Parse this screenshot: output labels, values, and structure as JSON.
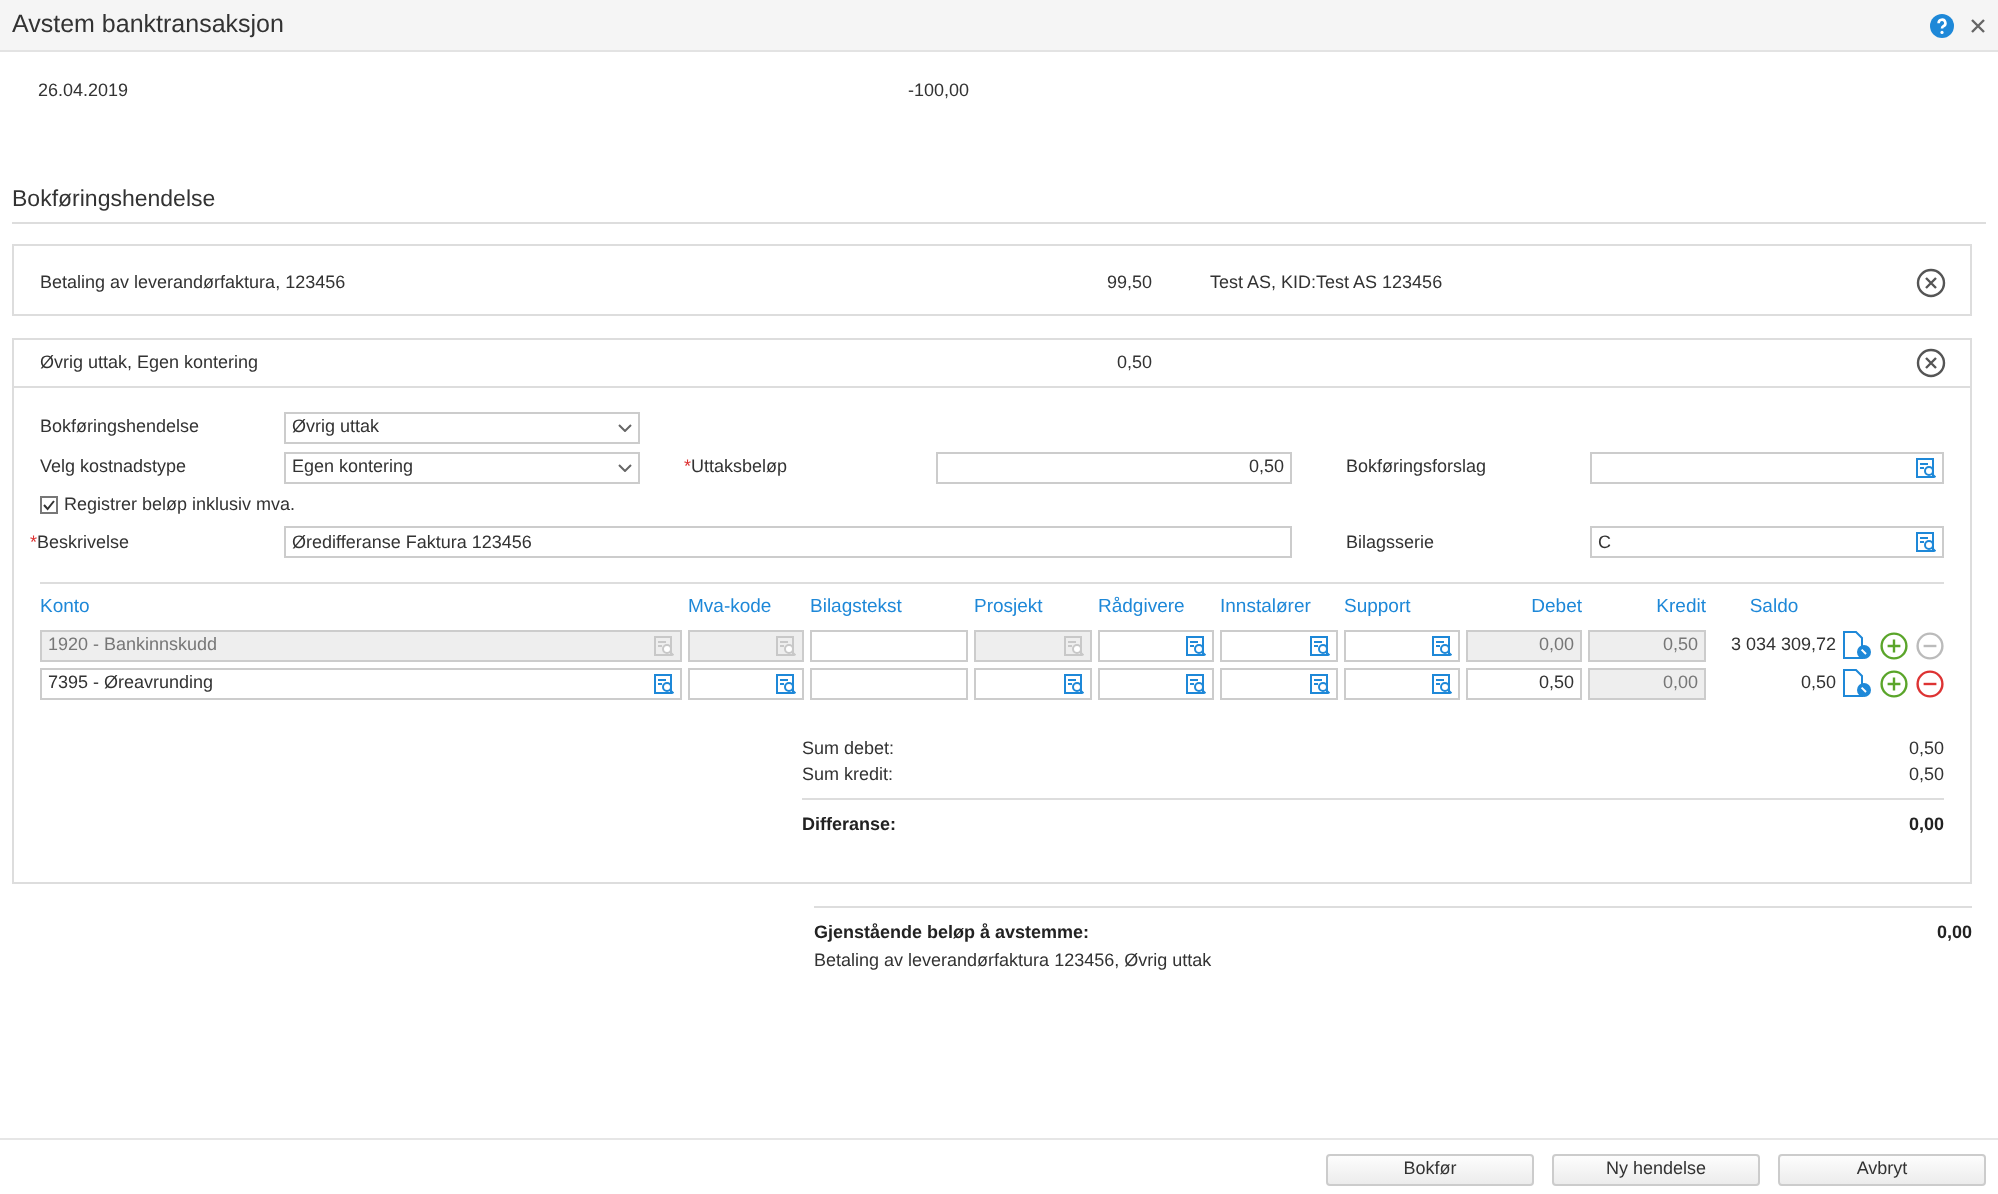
{
  "window": {
    "title": "Avstem banktransaksjon"
  },
  "transaction": {
    "date": "26.04.2019",
    "amount": "-100,00"
  },
  "section_title": "Bokføringshendelse",
  "events": [
    {
      "description": "Betaling av leverandørfaktura, 123456",
      "amount": "99,50",
      "reference": "Test AS, KID:Test AS 123456",
      "expanded": false
    },
    {
      "description": "Øvrig uttak, Egen kontering",
      "amount": "0,50",
      "expanded": true
    }
  ],
  "form": {
    "rows": [
      [
        {
          "kind": "select",
          "label": "Bokføringshendelse",
          "value": "Øvrig uttak"
        }
      ],
      [
        {
          "kind": "select",
          "label": "Velg kostnadstype",
          "value": "Egen kontering"
        },
        {
          "kind": "number",
          "label": "Uttaksbeløp",
          "required_mark": "*",
          "value": "0,50"
        },
        {
          "kind": "lookup",
          "label": "Bokføringsforslag"
        }
      ],
      [
        {
          "kind": "checkbox",
          "label": "Registrer beløp inklusiv mva.",
          "checked": true
        }
      ],
      [
        {
          "kind": "wide",
          "label": "Beskrivelse",
          "required_mark": "*",
          "value": "Øredifferanse Faktura 123456"
        },
        "",
        {
          "kind": "lookup",
          "label": "Bilagsserie",
          "value": "C"
        }
      ]
    ]
  },
  "table": {
    "columns": [
      "Konto",
      "Mva-kode",
      "Bilagstekst",
      "Prosjekt",
      "Rådgivere",
      "Innstalører",
      "Support",
      "Debet",
      "Kredit",
      "Saldo"
    ],
    "rows": [
      {
        "cells": [
          {
            "value": "1920 - Bankinnskudd",
            "disabled": true,
            "lookup": true
          },
          {
            "disabled": true,
            "lookup": true
          },
          {
            "disabled": false,
            "lookup": false
          },
          {
            "disabled": true,
            "lookup": true
          },
          {
            "disabled": false,
            "lookup": true
          },
          {
            "disabled": false,
            "lookup": true
          },
          {
            "disabled": false,
            "lookup": true
          },
          {
            "value": "0,00",
            "disabled": true,
            "lookup": false
          },
          {
            "value": "0,50",
            "disabled": true,
            "lookup": false
          }
        ],
        "saldo": "3 034 309,72",
        "can_remove": false
      },
      {
        "cells": [
          {
            "value": "7395 - Øreavrunding",
            "disabled": false,
            "lookup": true
          },
          {
            "disabled": false,
            "lookup": true
          },
          {
            "disabled": false,
            "lookup": false
          },
          {
            "disabled": false,
            "lookup": true
          },
          {
            "disabled": false,
            "lookup": true
          },
          {
            "disabled": false,
            "lookup": true
          },
          {
            "disabled": false,
            "lookup": true
          },
          {
            "value": "0,50",
            "disabled": false,
            "lookup": false
          },
          {
            "value": "0,00",
            "disabled": true,
            "lookup": false
          }
        ],
        "saldo": "0,50",
        "can_remove": true
      }
    ]
  },
  "totals": [
    {
      "label": "Sum debet:",
      "value": "0,50",
      "bold": false
    },
    {
      "label": "Sum kredit:",
      "value": "0,50",
      "bold": false
    },
    {
      "label": "Differanse:",
      "value": "0,00",
      "bold": true
    }
  ],
  "remaining": {
    "label": "Gjenstående beløp å avstemme:",
    "value": "0,00",
    "details": "Betaling av leverandørfaktura 123456, Øvrig uttak"
  },
  "buttons": [
    "Bokfør",
    "Ny hendelse",
    "Avbryt"
  ]
}
